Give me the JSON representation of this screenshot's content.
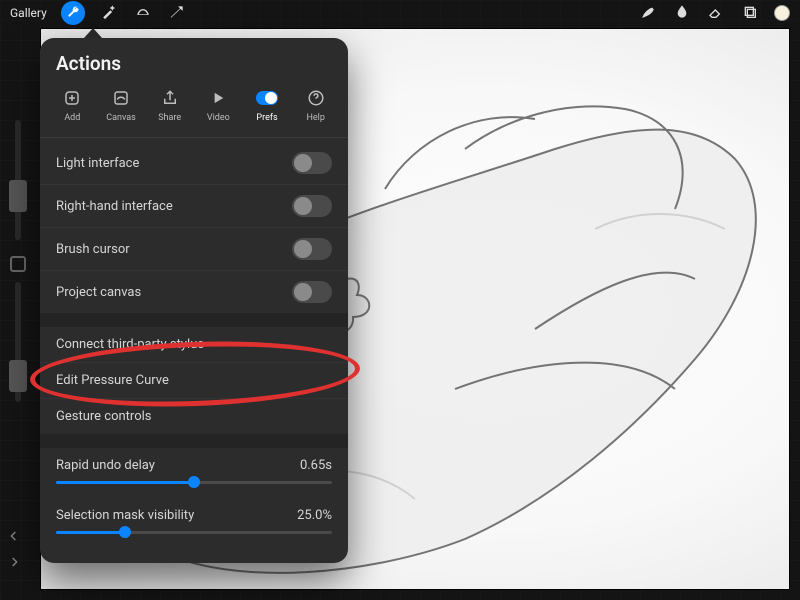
{
  "topbar": {
    "gallery": "Gallery"
  },
  "popover": {
    "title": "Actions",
    "tabs": {
      "add": "Add",
      "canvas": "Canvas",
      "share": "Share",
      "video": "Video",
      "prefs": "Prefs",
      "help": "Help"
    },
    "prefs": {
      "light_interface": "Light interface",
      "right_hand_interface": "Right-hand interface",
      "brush_cursor": "Brush cursor",
      "project_canvas": "Project canvas",
      "connect_stylus": "Connect third-party stylus",
      "edit_pressure_curve": "Edit Pressure Curve",
      "gesture_controls": "Gesture controls",
      "rapid_undo_label": "Rapid undo delay",
      "rapid_undo_value": "0.65s",
      "rapid_undo_pct": 50,
      "mask_vis_label": "Selection mask visibility",
      "mask_vis_value": "25.0%",
      "mask_vis_pct": 25
    }
  },
  "icons": {
    "wrench": "wrench-icon",
    "wand": "wand-icon",
    "select": "select-icon",
    "move": "move-icon",
    "brush": "brush-icon",
    "smudge": "smudge-icon",
    "eraser": "eraser-icon",
    "layers": "layers-icon",
    "color": "color-icon"
  },
  "colors": {
    "accent": "#0a84ff",
    "panel": "#2c2c2c",
    "annot": "#e03131"
  }
}
